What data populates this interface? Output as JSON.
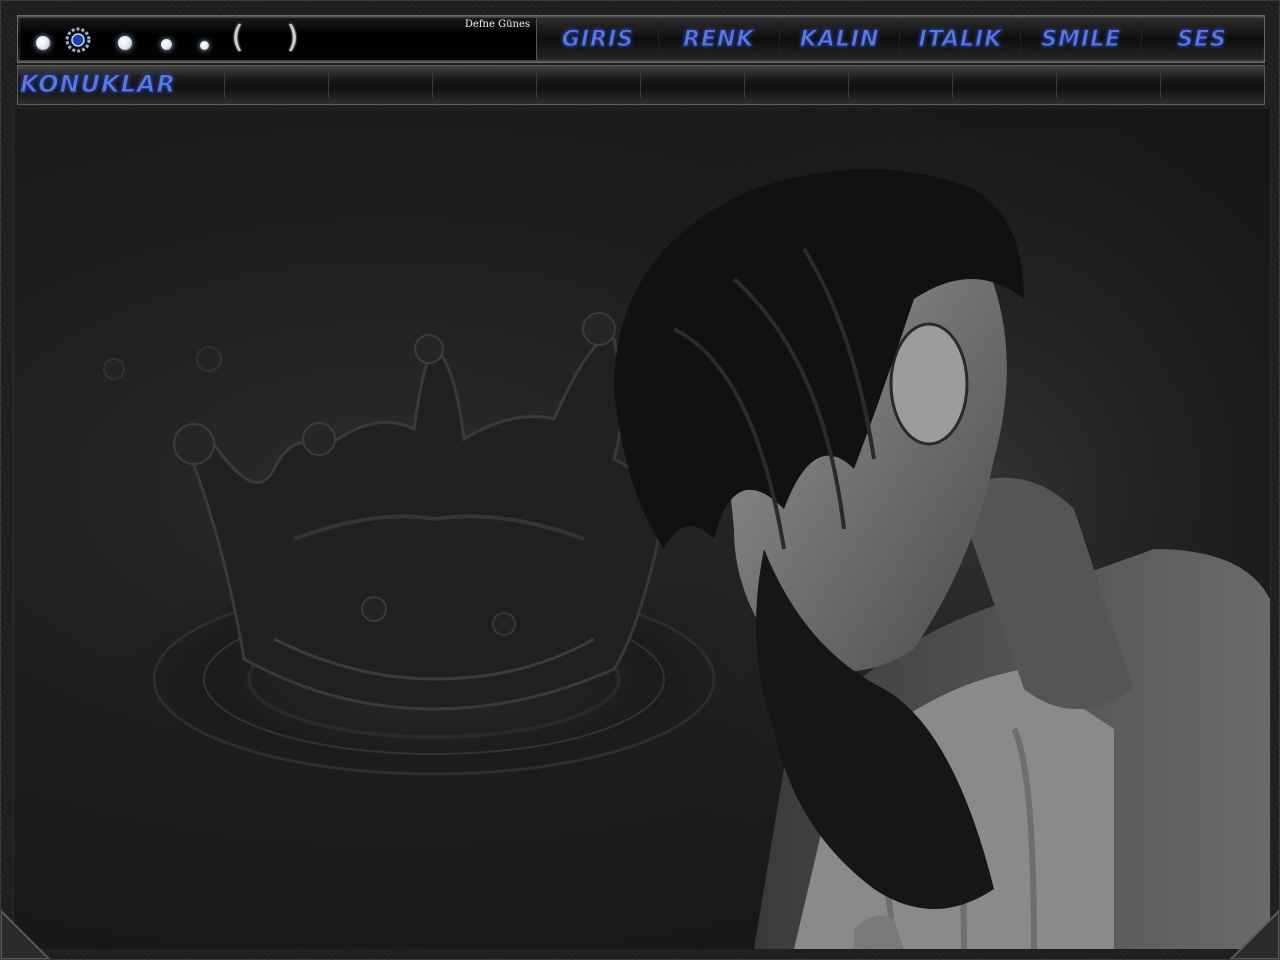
{
  "header": {
    "user_name": "Defne Günes",
    "controls": [
      "volume-dot",
      "settings-gear",
      "dot",
      "dot",
      "dot",
      "bracket-open",
      "bracket-close"
    ]
  },
  "menu": {
    "items": [
      {
        "label": "GIRIS"
      },
      {
        "label": "RENK"
      },
      {
        "label": "KALIN"
      },
      {
        "label": "ITALIK"
      },
      {
        "label": "SMILE"
      },
      {
        "label": "SES"
      }
    ]
  },
  "topics": {
    "label": "KONUKLAR"
  },
  "colors": {
    "menu_text": "#5b79d9",
    "menu_outline": "#1b2a7a",
    "background": "#1e1e1e"
  },
  "background_image": {
    "icons": [
      "crown-splash-image",
      "bearded-man-portrait"
    ]
  }
}
